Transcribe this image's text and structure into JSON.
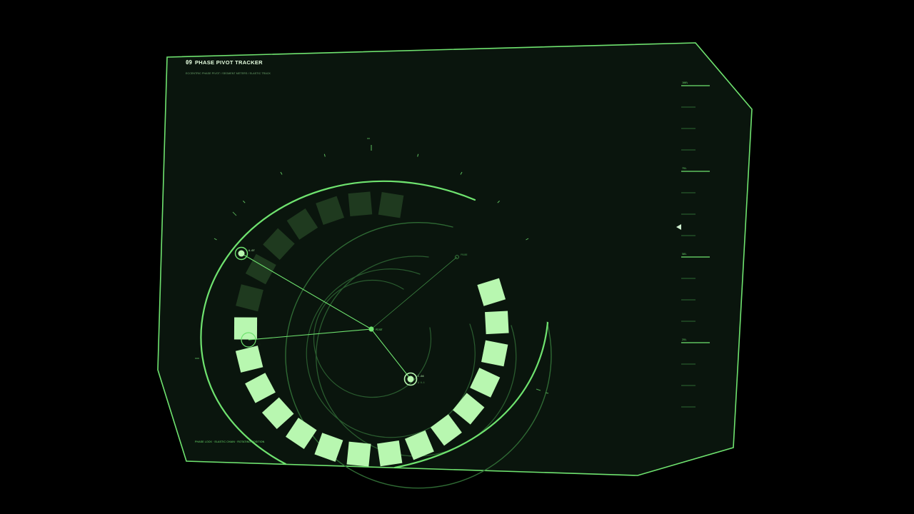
{
  "panel": {
    "index": "09",
    "title": "PHASE PIVOT TRACKER",
    "subtitle": "ECCENTRIC PHASE PIVOT / SEGMENT METERS / ELASTIC TRACK",
    "footer": "PHASE LOCK · ELASTIC CHAIN · ROTATING POSITION"
  },
  "meter": {
    "segments_total": 22,
    "segments_active": 15
  },
  "nodes": {
    "center_label": "PIVOT",
    "a_label": "A-07",
    "b_label": "B-13",
    "c_label": "C-04",
    "c_sub": "Δ 0.4",
    "probe_label": "PROBE"
  },
  "scale": {
    "marks": [
      "100%",
      "75%",
      "50%",
      "25%"
    ],
    "pointer_level": 0.68
  },
  "colors": {
    "accent": "#6fe36f",
    "segment_active": "#b8f7b0",
    "segment_dim": "#1f3a1f",
    "panel_bg": "#0a150d",
    "ring": "#2f6a34"
  }
}
